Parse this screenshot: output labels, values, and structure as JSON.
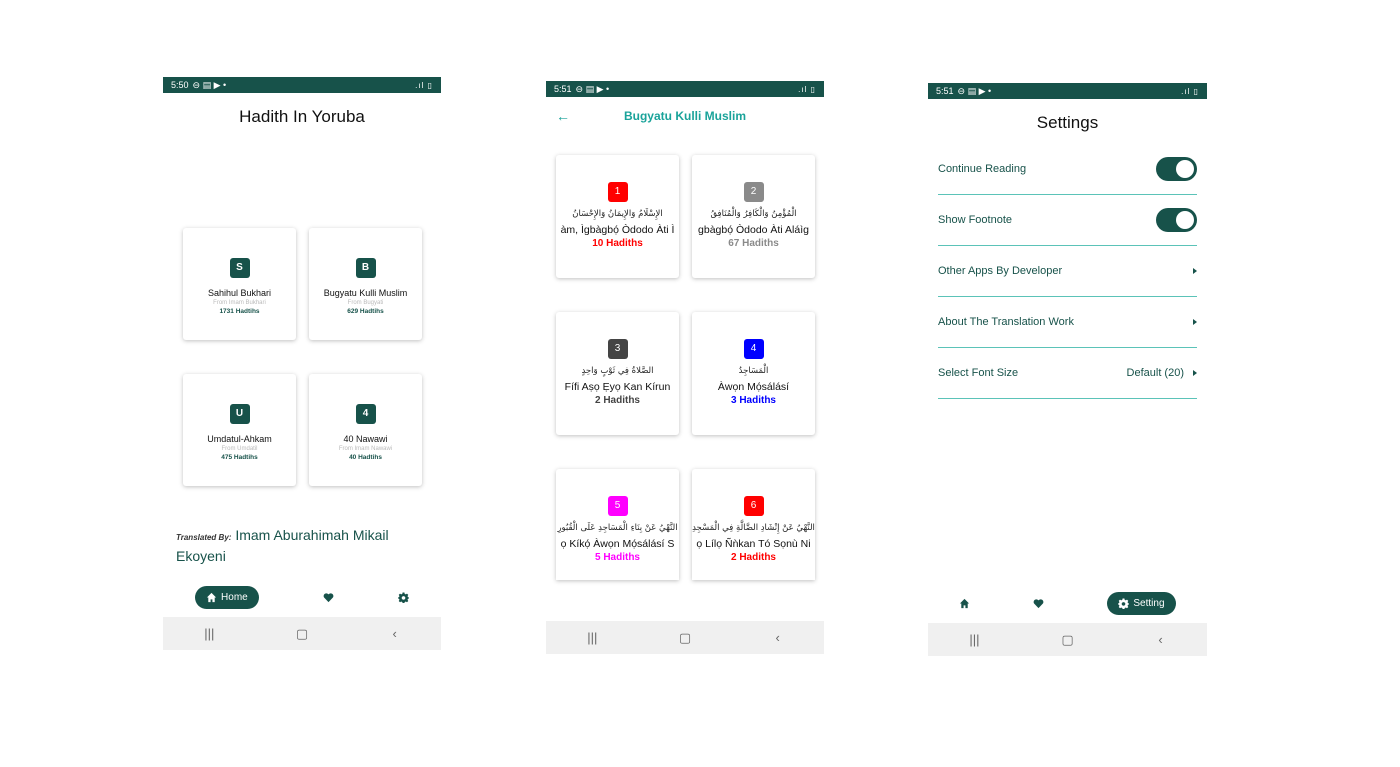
{
  "phone1": {
    "status": {
      "time": "5:50",
      "icons": "⊖ ▤ ▶ •",
      "right": ".ıl ▯"
    },
    "title": "Hadith In Yoruba",
    "books": [
      {
        "letter": "S",
        "name": "Sahihul Bukhari",
        "sub": "From Imam Bukhari",
        "count": "1731 Hadtihs"
      },
      {
        "letter": "B",
        "name": "Bugyatu Kulli Muslim",
        "sub": "From Bugyati",
        "count": "629 Hadtihs"
      },
      {
        "letter": "U",
        "name": "Umdatul-Ahkam",
        "sub": "From Umdatil",
        "count": "475 Hadtihs"
      },
      {
        "letter": "4",
        "name": "40 Nawawi",
        "sub": "From Imam Nawawi",
        "count": "40 Hadtihs"
      }
    ],
    "translated_label": "Translated By:",
    "translator": "Imam Aburahimah Mikail Ekoyeni",
    "nav": {
      "home": "Home"
    }
  },
  "phone2": {
    "status": {
      "time": "5:51",
      "icons": "⊖ ▤ ▶ •",
      "right": ".ıl ▯"
    },
    "title": "Bugyatu Kulli Muslim",
    "chapters": [
      {
        "num": "1",
        "color": "#ff0000",
        "arabic": "الإِسْلَامُ وَالإِيمَانُ وَالإِحْسَانُ",
        "title": "àm, Ìgbàgbọ́ Òdodo Àti Ì",
        "count": "10 Hadiths"
      },
      {
        "num": "2",
        "color": "#8a8a8a",
        "arabic": "الْمُؤْمِنُ وَالْكَافِرُ وَالْمُنَافِقُ",
        "title": "gbàgbọ́ Òdodo Àti Aláìg",
        "count": "67 Hadiths"
      },
      {
        "num": "3",
        "color": "#444444",
        "arabic": "الصَّلاةُ فِي ثَوْبٍ وَاحِدٍ",
        "title": "Fífi Aṣọ Ẹyọ Kan Kírun",
        "count": "2 Hadiths"
      },
      {
        "num": "4",
        "color": "#0000ff",
        "arabic": "الْمَسَاجِدُ",
        "title": "Àwọn Mọ́sálásí",
        "count": "3 Hadiths"
      },
      {
        "num": "5",
        "color": "#ff00ff",
        "arabic": "النَّهْيُ عَنْ بِنَاءِ الْمَسَاجِدِ عَلَى الْقُبُورِ",
        "title": "ọ Kíkọ́ Àwọn Mọ́sálásí S",
        "count": "5 Hadiths"
      },
      {
        "num": "6",
        "color": "#ff0000",
        "arabic": "النَّهْيُ عَنْ إِنْشَادِ الضَّالَّةِ فِي الْمَسْجِدِ",
        "title": "ọ Lílọ Ñǹkan Tó Sọnù Ni",
        "count": "2 Hadiths"
      }
    ]
  },
  "phone3": {
    "status": {
      "time": "5:51",
      "icons": "⊖ ▤ ▶ •",
      "right": ".ıl ▯"
    },
    "title": "Settings",
    "rows": {
      "continue_reading": "Continue Reading",
      "show_footnote": "Show Footnote",
      "other_apps": "Other Apps By Developer",
      "about": "About The Translation Work",
      "font_size": "Select Font Size",
      "font_size_value": "Default (20)"
    },
    "toggles": {
      "continue_reading": true,
      "show_footnote": true
    },
    "nav": {
      "setting": "Setting"
    }
  },
  "colors": {
    "primary": "#17524a",
    "accent": "#1aa39a",
    "divider": "#5bc3b8"
  }
}
